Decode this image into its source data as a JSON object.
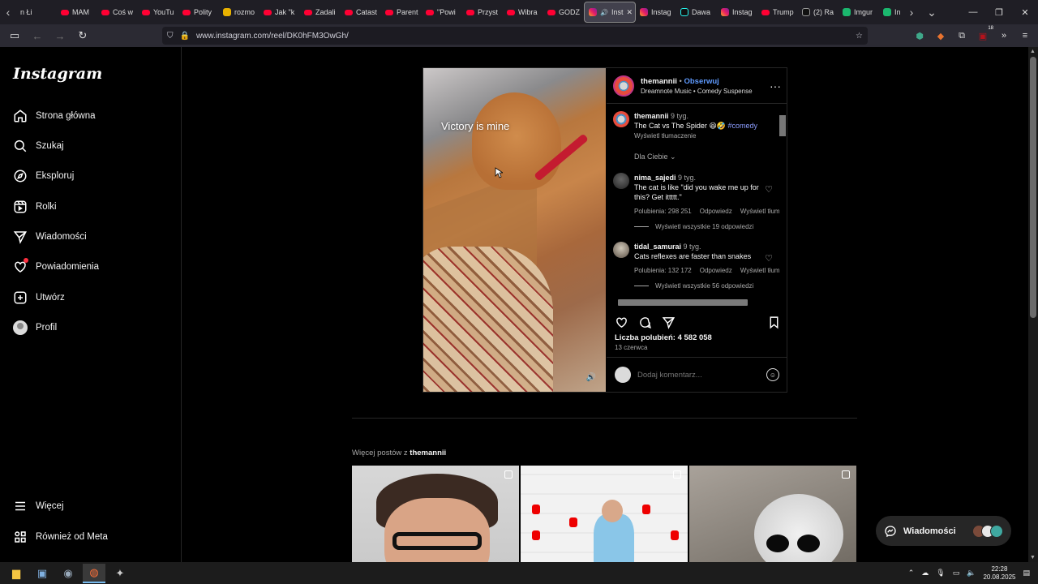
{
  "browser": {
    "tabs": [
      {
        "label": "n Łi",
        "icon": "none"
      },
      {
        "label": "MAM",
        "icon": "yt"
      },
      {
        "label": "Coś w",
        "icon": "yt"
      },
      {
        "label": "YouTu",
        "icon": "yt"
      },
      {
        "label": "Polity",
        "icon": "yt"
      },
      {
        "label": "rozmo",
        "icon": "pl"
      },
      {
        "label": "Jak \"k",
        "icon": "yt"
      },
      {
        "label": "Zadali",
        "icon": "yt"
      },
      {
        "label": "Catast",
        "icon": "yt"
      },
      {
        "label": "Parent",
        "icon": "yt"
      },
      {
        "label": "\"Powi",
        "icon": "yt"
      },
      {
        "label": "Przyst",
        "icon": "yt"
      },
      {
        "label": "Wibra",
        "icon": "yt"
      },
      {
        "label": "GODZ",
        "icon": "yt"
      },
      {
        "label": "Inst",
        "icon": "ig",
        "active": true
      },
      {
        "label": "Instag",
        "icon": "ig"
      },
      {
        "label": "Dawa",
        "icon": "tt"
      },
      {
        "label": "Instag",
        "icon": "ig"
      },
      {
        "label": "Trump",
        "icon": "yt"
      },
      {
        "label": "(2) Ra",
        "icon": "x"
      },
      {
        "label": "Imgur",
        "icon": "im"
      },
      {
        "label": "In",
        "icon": "im"
      }
    ],
    "url": "www.instagram.com/reel/DK0hFM3OwGh/",
    "ext_badge": "18"
  },
  "sidebar": {
    "logo": "Instagram",
    "items": [
      {
        "label": "Strona główna",
        "icon": "home-icon"
      },
      {
        "label": "Szukaj",
        "icon": "search-icon"
      },
      {
        "label": "Eksploruj",
        "icon": "compass-icon"
      },
      {
        "label": "Rolki",
        "icon": "reels-icon"
      },
      {
        "label": "Wiadomości",
        "icon": "messenger-icon"
      },
      {
        "label": "Powiadomienia",
        "icon": "heart-icon"
      },
      {
        "label": "Utwórz",
        "icon": "plus-square-icon"
      },
      {
        "label": "Profil",
        "icon": "profile-avatar"
      }
    ],
    "more": "Więcej",
    "meta": "Również od Meta"
  },
  "post": {
    "overlay_text": "Victory is mine",
    "author": "themannii",
    "follow": "Obserwuj",
    "separator": "•",
    "audio": "Dreamnote Music • Comedy Suspense",
    "caption": {
      "user": "themannii",
      "time": "9 tyg.",
      "text": "The Cat vs The Spider 😆🤣",
      "hashtag": "#comedy",
      "translate": "Wyświetl tłumaczenie"
    },
    "for_you": "Dla Ciebie",
    "comments": [
      {
        "user": "nima_sajedi",
        "time": "9 tyg.",
        "text": "The cat is like \"did you wake me up for this? Get ittttt.\"",
        "likes": "Polubienia: 298 251",
        "reply": "Odpowiedz",
        "translate": "Wyświetl tłum",
        "replies": "Wyświetl wszystkie 19 odpowiedzi"
      },
      {
        "user": "tidal_samurai",
        "time": "9 tyg.",
        "text": "Cats reflexes are faster than snakes",
        "likes": "Polubienia: 132 172",
        "reply": "Odpowiedz",
        "translate": "Wyświetl tłum",
        "replies": "Wyświetl wszystkie 56 odpowiedzi"
      }
    ],
    "like_count": "Liczba polubień: 4 582 058",
    "date": "13 czerwca",
    "comment_placeholder": "Dodaj komentarz..."
  },
  "more_posts": {
    "label": "Więcej postów z ",
    "user": "themannii"
  },
  "dm_float": {
    "label": "Wiadomości"
  },
  "taskbar": {
    "time": "22:28",
    "date": "20.08.2025"
  },
  "colors": {
    "link_blue": "#5f9bff",
    "hashtag": "#8c9dff",
    "notification_red": "#ff3040",
    "browser_bg": "#1f1e25"
  }
}
